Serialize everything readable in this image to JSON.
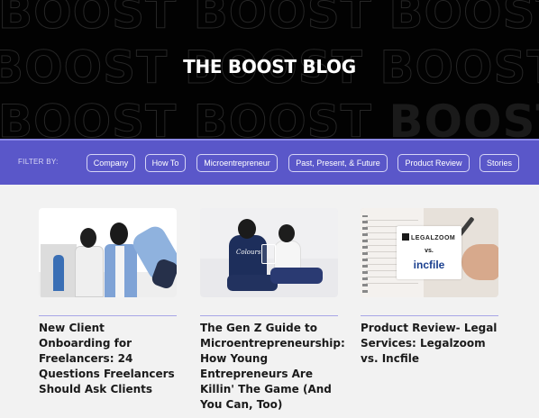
{
  "hero": {
    "watermark": "BOOST",
    "title": "THE BOOST BLOG"
  },
  "filter": {
    "label": "FILTER BY:",
    "chips": [
      "Company",
      "How To",
      "Microentrepreneur",
      "Past, Present, & Future",
      "Product Review",
      "Stories"
    ]
  },
  "posts": [
    {
      "title": "New Client Onboarding for Freelancers: 24 Questions Freelancers Should Ask Clients"
    },
    {
      "title": "The Gen Z Guide to Microentrepreneurship: How Young Entrepreneurs Are Killin' The Game (And You Can, Too)",
      "thumb_logo": "Colours"
    },
    {
      "title": "Product Review- Legal Services: Legalzoom vs. Incfile",
      "thumb_brand1": "LEGALZOOM",
      "thumb_vs": "vs.",
      "thumb_brand2": "incfile"
    }
  ],
  "colors": {
    "hero_bg": "#020202",
    "filter_bg": "#5a57c9",
    "page_bg": "#f2f2f2",
    "divider": "#a8a6e6"
  }
}
